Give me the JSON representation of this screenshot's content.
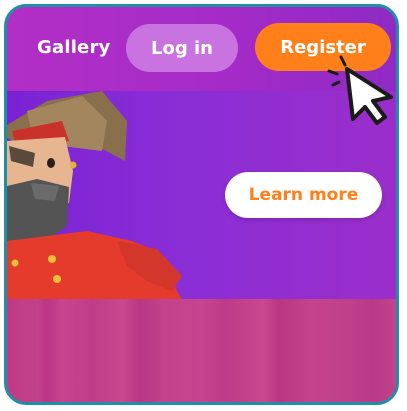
{
  "header": {
    "gallery_label": "Gallery",
    "login_label": "Log in",
    "register_label": "Register"
  },
  "hero": {
    "learn_more_label": "Learn more"
  },
  "colors": {
    "header_purple": "#a52bc8",
    "hero_purple": "#8a2ed6",
    "register_orange": "#ff7f1a",
    "login_pill": "#c873df",
    "bottom_pink": "#c0408a",
    "frame_border": "#1e8fa6"
  },
  "icons": {
    "cursor": "pointer-cursor-icon",
    "character": "pirate-character-illustration"
  }
}
